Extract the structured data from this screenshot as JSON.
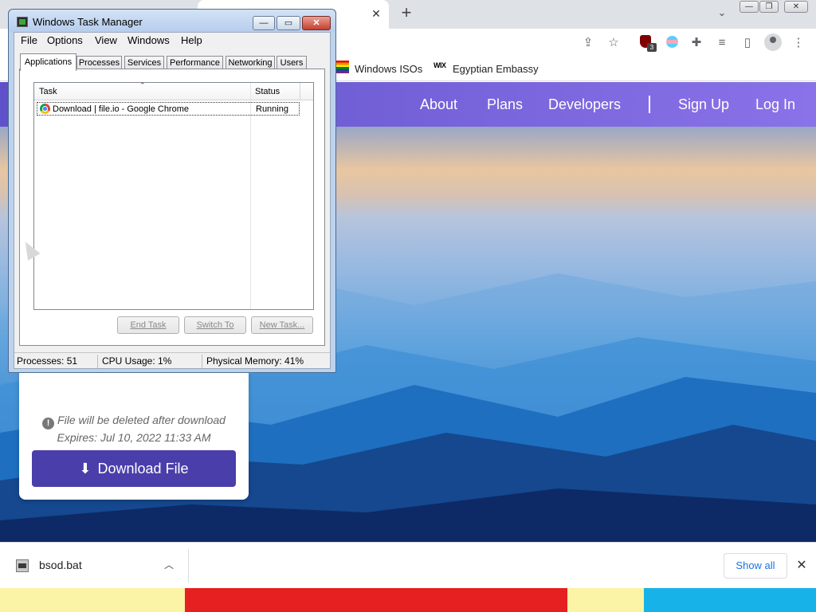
{
  "browser": {
    "tab_close_glyph": "✕",
    "new_tab_glyph": "+",
    "tab_search_glyph": "⌄",
    "window_controls": [
      "—",
      "❐",
      "✕"
    ],
    "toolbar_icons": [
      "share-icon",
      "star-icon",
      "ublock-icon",
      "extension-icon",
      "puzzle-icon",
      "media-icon",
      "sidepanel-icon",
      "profile-icon",
      "menu-icon"
    ],
    "ublock_badge": "3",
    "bookmarks": [
      {
        "label": "Windows ISOs",
        "icon": "rainbow-flag-icon"
      },
      {
        "label": "Egyptian Embassy",
        "icon": "wix-icon",
        "icon_text": "WIX"
      }
    ]
  },
  "page": {
    "nav": {
      "links": [
        "About",
        "Plans",
        "Developers"
      ],
      "auth": [
        "Sign Up",
        "Log In"
      ]
    },
    "card": {
      "notice_line1": "File will be deleted after download",
      "notice_line2": "Expires: Jul 10, 2022 11:33 AM",
      "download_label": "Download File"
    }
  },
  "download_shelf": {
    "file_name": "bsod.bat",
    "show_all_label": "Show all"
  },
  "task_manager": {
    "title": "Windows Task Manager",
    "menu": [
      "File",
      "Options",
      "View",
      "Windows",
      "Help"
    ],
    "tabs": [
      "Applications",
      "Processes",
      "Services",
      "Performance",
      "Networking",
      "Users"
    ],
    "active_tab": "Applications",
    "columns": {
      "task": "Task",
      "status": "Status"
    },
    "tasks": [
      {
        "name": "Download | file.io - Google Chrome",
        "status": "Running"
      }
    ],
    "buttons": {
      "end_task": "End Task",
      "switch_to": "Switch To",
      "new_task": "New Task..."
    },
    "status_bar": {
      "processes": "Processes: 51",
      "cpu": "CPU Usage: 1%",
      "memory": "Physical Memory: 41%"
    }
  },
  "colors": {
    "nav_start": "#5f51c9",
    "nav_end": "#8a72e8",
    "download_button": "#4a3eaa",
    "show_all_text": "#1a73e8"
  }
}
